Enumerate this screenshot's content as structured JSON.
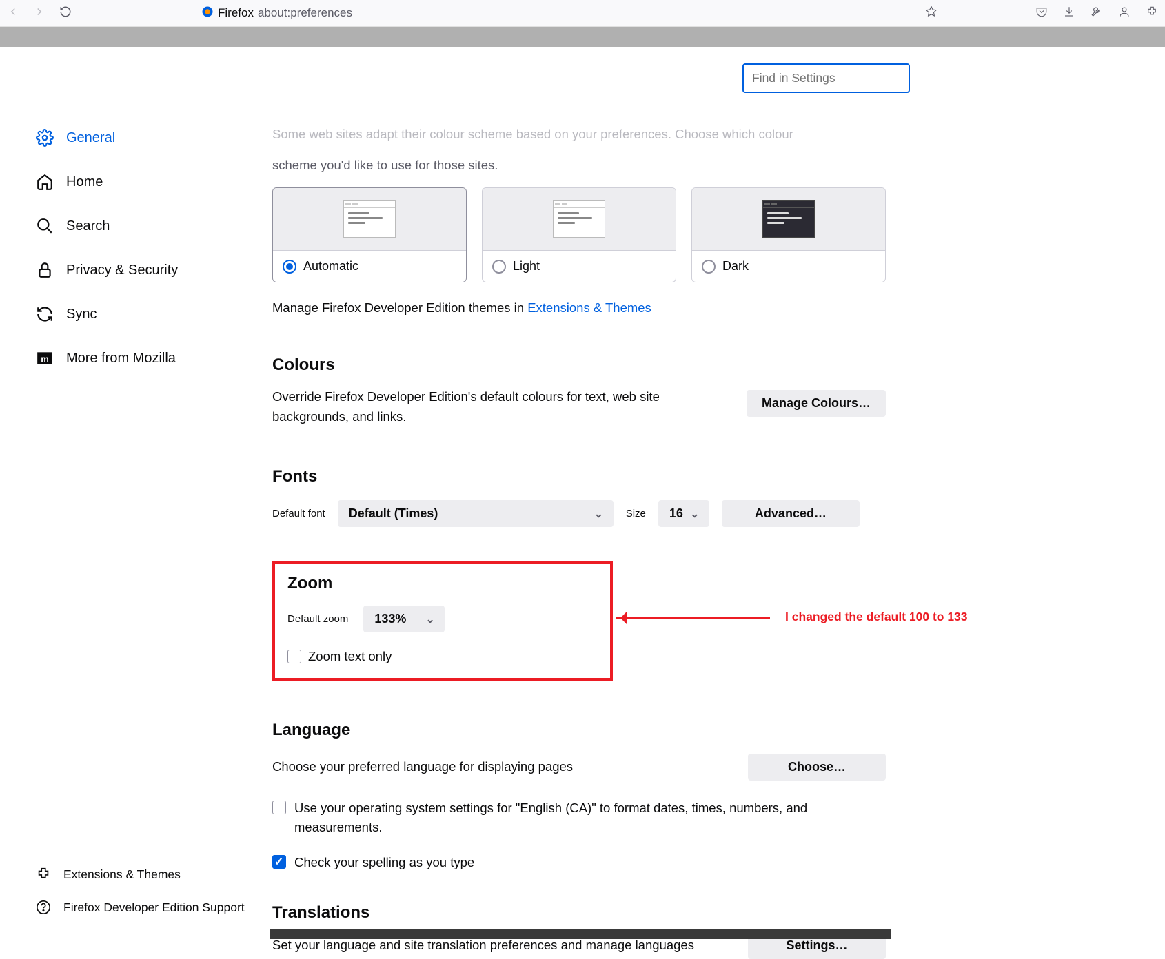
{
  "chrome": {
    "tab_label": "Firefox",
    "url": "about:preferences"
  },
  "search": {
    "placeholder": "Find in Settings"
  },
  "sidebar": {
    "items": [
      {
        "label": "General"
      },
      {
        "label": "Home"
      },
      {
        "label": "Search"
      },
      {
        "label": "Privacy & Security"
      },
      {
        "label": "Sync"
      },
      {
        "label": "More from Mozilla"
      }
    ],
    "bottom": [
      {
        "label": "Extensions & Themes"
      },
      {
        "label": "Firefox Developer Edition Support"
      }
    ]
  },
  "appearance": {
    "desc_cut": "Some web sites adapt their colour scheme based on your preferences. Choose which colour",
    "desc_cont": "scheme you'd like to use for those sites.",
    "options": [
      {
        "label": "Automatic"
      },
      {
        "label": "Light"
      },
      {
        "label": "Dark"
      }
    ],
    "themes_prefix": "Manage Firefox Developer Edition themes in ",
    "themes_link": "Extensions & Themes"
  },
  "colours": {
    "heading": "Colours",
    "desc": "Override Firefox Developer Edition's default colours for text, web site backgrounds, and links.",
    "button": "Manage Colours…"
  },
  "fonts": {
    "heading": "Fonts",
    "default_label": "Default font",
    "default_value": "Default (Times)",
    "size_label": "Size",
    "size_value": "16",
    "advanced": "Advanced…"
  },
  "zoom": {
    "heading": "Zoom",
    "default_label": "Default zoom",
    "default_value": "133%",
    "text_only": "Zoom text only",
    "annotation": "I changed the default 100 to 133"
  },
  "language": {
    "heading": "Language",
    "desc": "Choose your preferred language for displaying pages",
    "choose": "Choose…",
    "os_settings": "Use your operating system settings for \"English (CA)\" to format dates, times, numbers, and measurements.",
    "spellcheck": "Check your spelling as you type"
  },
  "translations": {
    "heading": "Translations",
    "desc": "Set your language and site translation preferences and manage languages",
    "settings": "Settings…"
  }
}
